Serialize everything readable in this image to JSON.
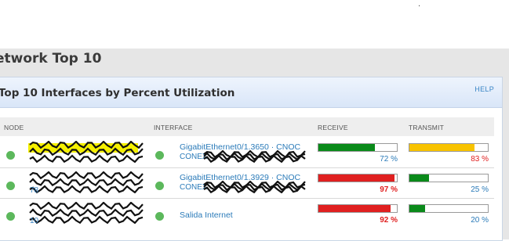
{
  "misc": {
    "corner_mark": "."
  },
  "page": {
    "title": "etwork Top 10"
  },
  "panel": {
    "title": "Top 10 Interfaces by Percent Utilization",
    "help": "HELP"
  },
  "columns": {
    "node": "NODE",
    "interface": "INTERFACE",
    "receive": "RECEIVE",
    "transmit": "TRANSMIT"
  },
  "colors": {
    "green": "#0a8a1a",
    "red": "#e02020",
    "yellow": "#f8c300",
    "status_up": "#5cb85c",
    "link": "#2b7bb9",
    "pct_red": "#e02020",
    "pct_blue": "#2b7bb9"
  },
  "rows": [
    {
      "node_line2": "",
      "interface": "GigabitEthernet0/1.3650 · CNOC",
      "interface_line2": "CONEX",
      "receive": 72,
      "receive_label": "72 %",
      "receive_color": "green",
      "transmit": 83,
      "transmit_label": "83 %",
      "transmit_color": "yellow"
    },
    {
      "node_line2": "78",
      "interface": "GigabitEthernet0/1.3929 · CNOC",
      "interface_line2": "CONEX",
      "receive": 97,
      "receive_label": "97 %",
      "receive_color": "red",
      "transmit": 25,
      "transmit_label": "25 %",
      "transmit_color": "green"
    },
    {
      "node_line2": "10",
      "interface": "Salida Internet",
      "interface_line2": "",
      "receive": 92,
      "receive_label": "92 %",
      "receive_color": "red",
      "transmit": 20,
      "transmit_label": "20 %",
      "transmit_color": "green"
    }
  ]
}
